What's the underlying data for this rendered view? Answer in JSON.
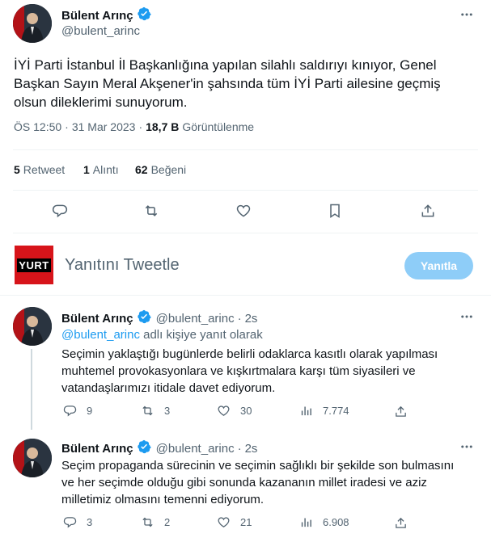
{
  "colors": {
    "accent": "#1d9bf0",
    "muted": "#536471",
    "text": "#0f1419",
    "divider": "#eff3f4",
    "reply_button_bg": "#8ecdf8"
  },
  "main_tweet": {
    "author_name": "Bülent Arınç",
    "author_handle": "@bulent_arinc",
    "more_icon": "more-dots-icon",
    "text": "İYİ Parti İstanbul İl Başkanlığına yapılan silahlı saldırıyı kınıyor, Genel Başkan Sayın Meral Akşener'in şahsında tüm İYİ Parti ailesine geçmiş olsun dileklerimi sunuyorum.",
    "time": "ÖS 12:50",
    "separator": "·",
    "date": "31 Mar 2023",
    "views_value": "18,7 B",
    "views_label": "Görüntülenme",
    "retweets_value": "5",
    "retweets_label": "Retweet",
    "quotes_value": "1",
    "quotes_label": "Alıntı",
    "likes_value": "62",
    "likes_label": "Beğeni",
    "actions": [
      "reply-icon",
      "retweet-icon",
      "like-icon",
      "bookmark-icon",
      "share-icon"
    ]
  },
  "compose": {
    "avatar_text": "YURT",
    "placeholder": "Yanıtını Tweetle",
    "reply_button": "Yanıtla"
  },
  "replies": [
    {
      "author_name": "Bülent Arınç",
      "author_handle": "@bulent_arinc",
      "separator": "·",
      "time_ago": "2s",
      "replying_mention": "@bulent_arinc",
      "replying_suffix": "adlı kişiye yanıt olarak",
      "text": "Seçimin yaklaştığı bugünlerde belirli odaklarca kasıtlı olarak yapılması muhtemel provokasyonlara ve kışkırtmalara karşı tüm siyasileri ve vatandaşlarımızı itidale davet ediyorum.",
      "reply_count": "9",
      "retweet_count": "3",
      "like_count": "30",
      "view_count": "7.774"
    },
    {
      "author_name": "Bülent Arınç",
      "author_handle": "@bulent_arinc",
      "separator": "·",
      "time_ago": "2s",
      "text": "Seçim propaganda sürecinin ve seçimin sağlıklı bir şekilde son bulmasını ve her seçimde olduğu gibi sonunda kazananın millet iradesi ve aziz milletimiz olmasını temenni ediyorum.",
      "reply_count": "3",
      "retweet_count": "2",
      "like_count": "21",
      "view_count": "6.908"
    }
  ]
}
